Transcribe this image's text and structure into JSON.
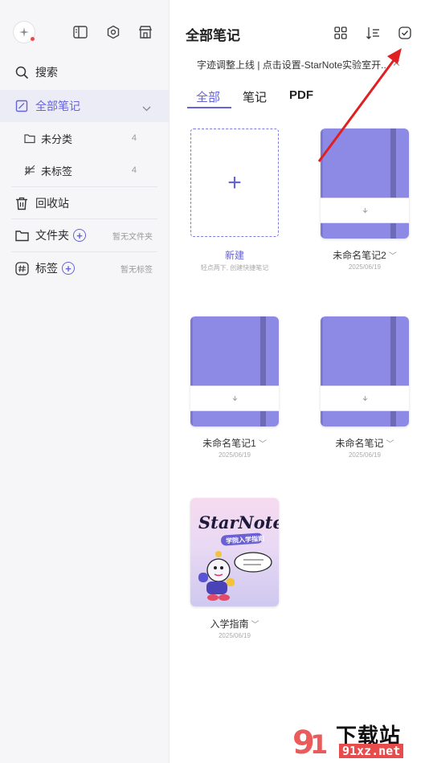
{
  "sidebar": {
    "search": "搜索",
    "all_notes": "全部笔记",
    "uncategorized": "未分类",
    "uncategorized_count": "4",
    "untagged": "未标签",
    "untagged_count": "4",
    "trash": "回收站",
    "folders": "文件夹",
    "folders_hint": "暂无文件夹",
    "tags": "标签",
    "tags_hint": "暂无标签"
  },
  "main": {
    "title": "全部笔记",
    "banner": "字迹调整上线 | 点击设置-StarNote实验室开...",
    "tabs": [
      "全部",
      "笔记",
      "PDF"
    ],
    "new_card": {
      "label": "新建",
      "hint": "轻点两下, 创建快捷笔记"
    },
    "notes": [
      {
        "title": "未命名笔记2",
        "date": "2025/06/19"
      },
      {
        "title": "未命名笔记1",
        "date": "2025/06/19"
      },
      {
        "title": "未命名笔记",
        "date": "2025/06/19"
      },
      {
        "title": "入学指南",
        "date": "2025/06/19"
      }
    ],
    "guide_cover": {
      "brand": "StarNote",
      "subtitle": "学院入学指南"
    }
  },
  "colors": {
    "accent": "#6563d8",
    "notebook": "#8d8ae6",
    "arrow": "#e02020"
  },
  "watermark": {
    "big": "下载站",
    "small": "91xz.net"
  }
}
